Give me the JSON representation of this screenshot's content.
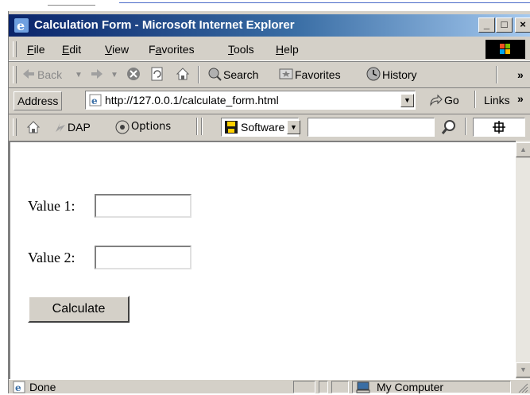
{
  "window": {
    "title": "Calculation Form - Microsoft Internet Explorer",
    "minimize_glyph": "_",
    "maximize_glyph": "□",
    "close_glyph": "×"
  },
  "menu": {
    "items": [
      {
        "key": "F",
        "rest": "ile"
      },
      {
        "key": "E",
        "rest": "dit"
      },
      {
        "key": "V",
        "rest": "iew"
      },
      {
        "pre": "F",
        "key": "a",
        "rest": "vorites"
      },
      {
        "key": "T",
        "rest": "ools"
      },
      {
        "key": "H",
        "rest": "elp"
      }
    ]
  },
  "toolbar": {
    "back_label": "Back",
    "search_label": "Search",
    "favorites_label": "Favorites",
    "history_label": "History",
    "overflow": "»"
  },
  "address": {
    "label": "Address",
    "url": "http://127.0.0.1/calculate_form.html",
    "go_label": "Go",
    "links_label": "Links",
    "links_overflow": "»"
  },
  "linkbar": {
    "dap_label": "DAP",
    "options_label": "Options",
    "software_label": "Software",
    "search_value": ""
  },
  "form": {
    "value1_label": "Value 1:",
    "value1": "",
    "value2_label": "Value 2:",
    "value2": "",
    "calculate_label": "Calculate"
  },
  "status": {
    "text": "Done",
    "zone": "My Computer"
  },
  "colors": {
    "title_active": "#0a246a",
    "chrome": "#d4d0c8"
  },
  "icons": [
    "ie-icon",
    "windows-logo-icon",
    "back-arrow-icon",
    "forward-arrow-icon",
    "stop-icon",
    "refresh-icon",
    "home-icon",
    "search-globe-icon",
    "favorites-icon",
    "history-icon",
    "go-arrow-icon",
    "ie-page-icon",
    "dap-icon",
    "options-icon",
    "software-icon",
    "magnifier-icon",
    "grid-icon",
    "computer-icon"
  ]
}
